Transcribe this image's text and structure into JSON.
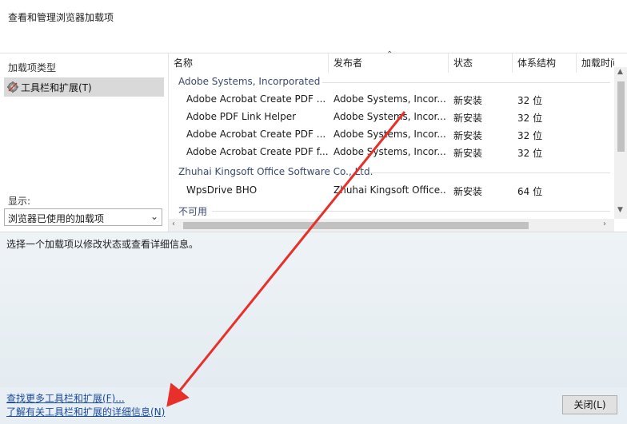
{
  "header": {
    "title": "查看和管理浏览器加载项"
  },
  "sidebar": {
    "types_label": "加载项类型",
    "items": [
      {
        "label": "工具栏和扩展(T)",
        "icon": "toolbar-gear-icon"
      }
    ],
    "show_label": "显示:",
    "show_select": {
      "value": "浏览器已使用的加载项"
    }
  },
  "list": {
    "columns": [
      "名称",
      "发布者",
      "状态",
      "体系结构",
      "加载时间"
    ],
    "groups": [
      {
        "name": "Adobe Systems, Incorporated",
        "rows": [
          {
            "name": "Adobe Acrobat Create PDF ...",
            "publisher": "Adobe Systems, Incor...",
            "status": "新安装",
            "arch": "32 位"
          },
          {
            "name": "Adobe PDF Link Helper",
            "publisher": "Adobe Systems, Incor...",
            "status": "新安装",
            "arch": "32 位"
          },
          {
            "name": "Adobe Acrobat Create PDF ...",
            "publisher": "Adobe Systems, Incor...",
            "status": "新安装",
            "arch": "32 位"
          },
          {
            "name": "Adobe Acrobat Create PDF f...",
            "publisher": "Adobe Systems, Incor...",
            "status": "新安装",
            "arch": "32 位"
          }
        ]
      },
      {
        "name": "Zhuhai Kingsoft Office Software Co., Ltd.",
        "rows": [
          {
            "name": "WpsDrive BHO",
            "publisher": "Zhuhai Kingsoft Office...",
            "status": "新安装",
            "arch": "64 位"
          }
        ]
      },
      {
        "name": "不可用",
        "rows": []
      }
    ]
  },
  "details": {
    "hint": "选择一个加载项以修改状态或查看详细信息。"
  },
  "footer": {
    "link_find": "查找更多工具栏和扩展(F)...",
    "link_learn": "了解有关工具栏和扩展的详细信息(N)",
    "close_label": "关闭(L)"
  },
  "colors": {
    "annotation_arrow": "#e8302a",
    "link": "#1a4a9c",
    "selection": "#d9d9d9"
  }
}
